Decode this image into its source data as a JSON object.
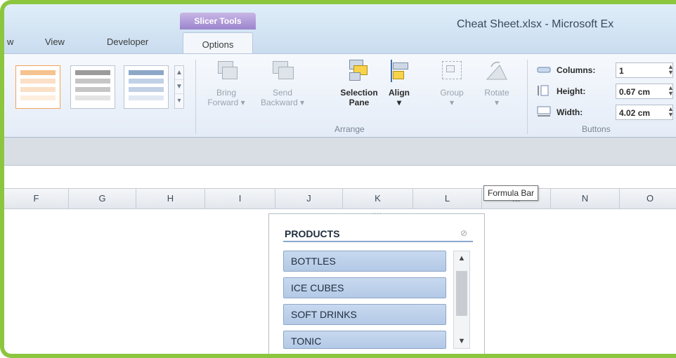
{
  "window": {
    "title": "Cheat Sheet.xlsx - Microsoft Ex"
  },
  "tabs": {
    "partial": "w",
    "view": "View",
    "developer": "Developer",
    "context_group": "Slicer Tools",
    "options": "Options"
  },
  "ribbon": {
    "bring_forward": {
      "line1": "Bring",
      "line2": "Forward ▾",
      "icon": "bring-forward-icon"
    },
    "send_backward": {
      "line1": "Send",
      "line2": "Backward ▾",
      "icon": "send-backward-icon"
    },
    "selection_pane": {
      "line1": "Selection",
      "line2": "Pane",
      "icon": "selection-pane-icon"
    },
    "align": {
      "line1": "Align",
      "line2": "▾",
      "icon": "align-icon"
    },
    "group": {
      "line1": "Group",
      "line2": "▾",
      "icon": "group-icon"
    },
    "rotate": {
      "line1": "Rotate",
      "line2": "▾",
      "icon": "rotate-icon"
    },
    "arrange_label": "Arrange",
    "buttons_label": "Buttons",
    "columns": {
      "label": "Columns:",
      "value": "1"
    },
    "height": {
      "label": "Height:",
      "value": "0.67 cm"
    },
    "width": {
      "label": "Width:",
      "value": "4.02 cm"
    }
  },
  "tooltip": "Formula Bar",
  "columns": [
    "F",
    "G",
    "H",
    "I",
    "J",
    "K",
    "L",
    "M",
    "N",
    "O"
  ],
  "slicer": {
    "title": "PRODUCTS",
    "items": [
      "BOTTLES",
      "ICE CUBES",
      "SOFT DRINKS",
      "TONIC"
    ]
  },
  "colors": {
    "frame_border": "#8cc63f",
    "context_tab": "#9c84cc",
    "slicer_item": "#b3c9e6"
  }
}
